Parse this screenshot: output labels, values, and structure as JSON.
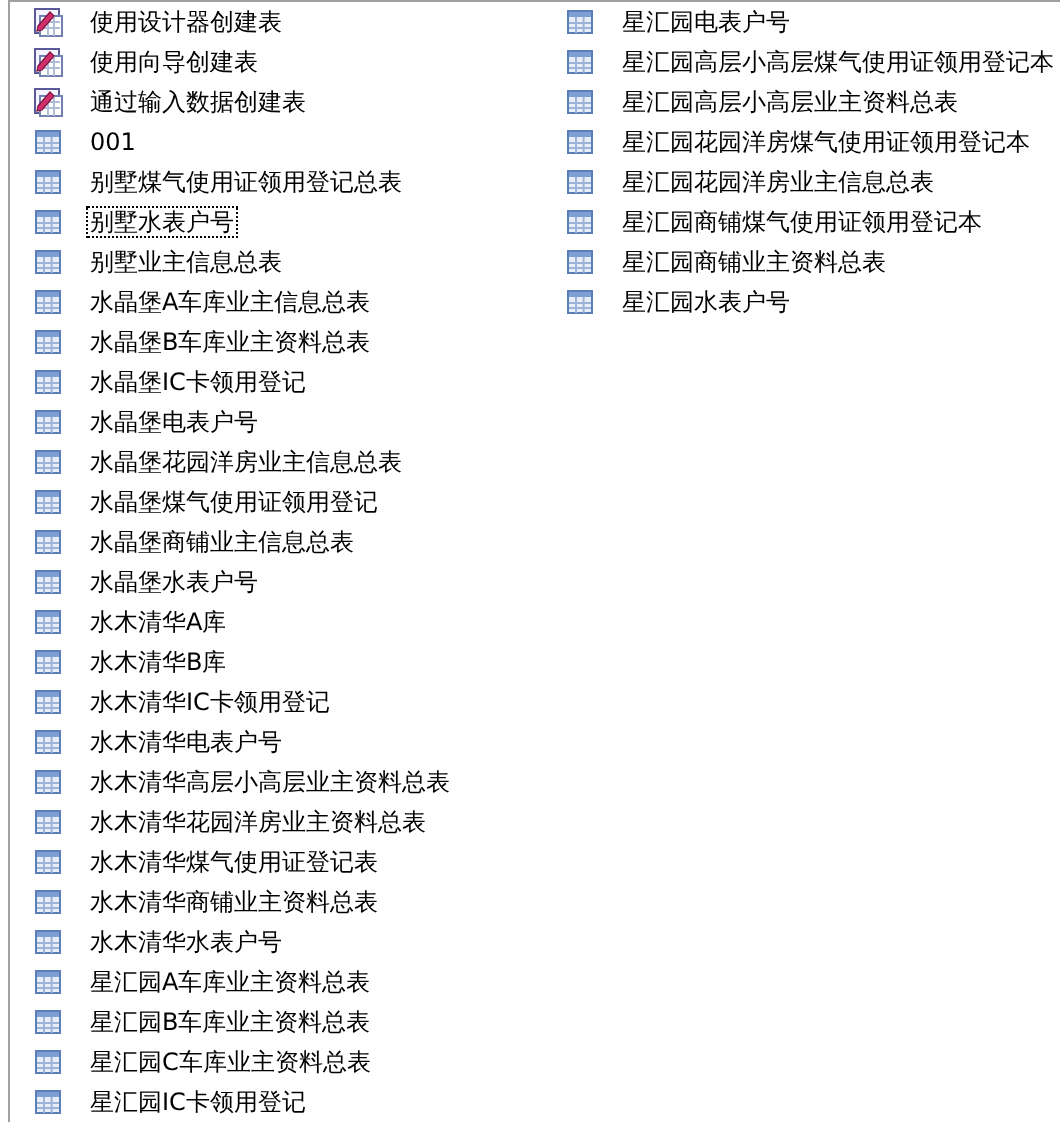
{
  "objects": [
    {
      "kind": "shortcut",
      "label": "使用设计器创建表",
      "selected": false
    },
    {
      "kind": "shortcut",
      "label": "使用向导创建表",
      "selected": false
    },
    {
      "kind": "shortcut",
      "label": "通过输入数据创建表",
      "selected": false
    },
    {
      "kind": "table",
      "label": "001",
      "selected": false
    },
    {
      "kind": "table",
      "label": "别墅煤气使用证领用登记总表",
      "selected": false
    },
    {
      "kind": "table",
      "label": "别墅水表户号",
      "selected": true
    },
    {
      "kind": "table",
      "label": "别墅业主信息总表",
      "selected": false
    },
    {
      "kind": "table",
      "label": "水晶堡A车库业主信息总表",
      "selected": false
    },
    {
      "kind": "table",
      "label": "水晶堡B车库业主资料总表",
      "selected": false
    },
    {
      "kind": "table",
      "label": "水晶堡IC卡领用登记",
      "selected": false
    },
    {
      "kind": "table",
      "label": "水晶堡电表户号",
      "selected": false
    },
    {
      "kind": "table",
      "label": "水晶堡花园洋房业主信息总表",
      "selected": false
    },
    {
      "kind": "table",
      "label": "水晶堡煤气使用证领用登记",
      "selected": false
    },
    {
      "kind": "table",
      "label": "水晶堡商铺业主信息总表",
      "selected": false
    },
    {
      "kind": "table",
      "label": "水晶堡水表户号",
      "selected": false
    },
    {
      "kind": "table",
      "label": "水木清华A库",
      "selected": false
    },
    {
      "kind": "table",
      "label": "水木清华B库",
      "selected": false
    },
    {
      "kind": "table",
      "label": "水木清华IC卡领用登记",
      "selected": false
    },
    {
      "kind": "table",
      "label": "水木清华电表户号",
      "selected": false
    },
    {
      "kind": "table",
      "label": "水木清华高层小高层业主资料总表",
      "selected": false
    },
    {
      "kind": "table",
      "label": "水木清华花园洋房业主资料总表",
      "selected": false
    },
    {
      "kind": "table",
      "label": "水木清华煤气使用证登记表",
      "selected": false
    },
    {
      "kind": "table",
      "label": "水木清华商铺业主资料总表",
      "selected": false
    },
    {
      "kind": "table",
      "label": "水木清华水表户号",
      "selected": false
    },
    {
      "kind": "table",
      "label": "星汇园A车库业主资料总表",
      "selected": false
    },
    {
      "kind": "table",
      "label": "星汇园B车库业主资料总表",
      "selected": false
    },
    {
      "kind": "table",
      "label": "星汇园C车库业主资料总表",
      "selected": false
    },
    {
      "kind": "table",
      "label": "星汇园IC卡领用登记",
      "selected": false
    },
    {
      "kind": "table",
      "label": "星汇园电表户号",
      "selected": false
    },
    {
      "kind": "table",
      "label": "星汇园高层小高层煤气使用证领用登记本",
      "selected": false
    },
    {
      "kind": "table",
      "label": "星汇园高层小高层业主资料总表",
      "selected": false
    },
    {
      "kind": "table",
      "label": "星汇园花园洋房煤气使用证领用登记本",
      "selected": false
    },
    {
      "kind": "table",
      "label": "星汇园花园洋房业主信息总表",
      "selected": false
    },
    {
      "kind": "table",
      "label": "星汇园商铺煤气使用证领用登记本",
      "selected": false
    },
    {
      "kind": "table",
      "label": "星汇园商铺业主资料总表",
      "selected": false
    },
    {
      "kind": "table",
      "label": "星汇园水表户号",
      "selected": false
    }
  ]
}
